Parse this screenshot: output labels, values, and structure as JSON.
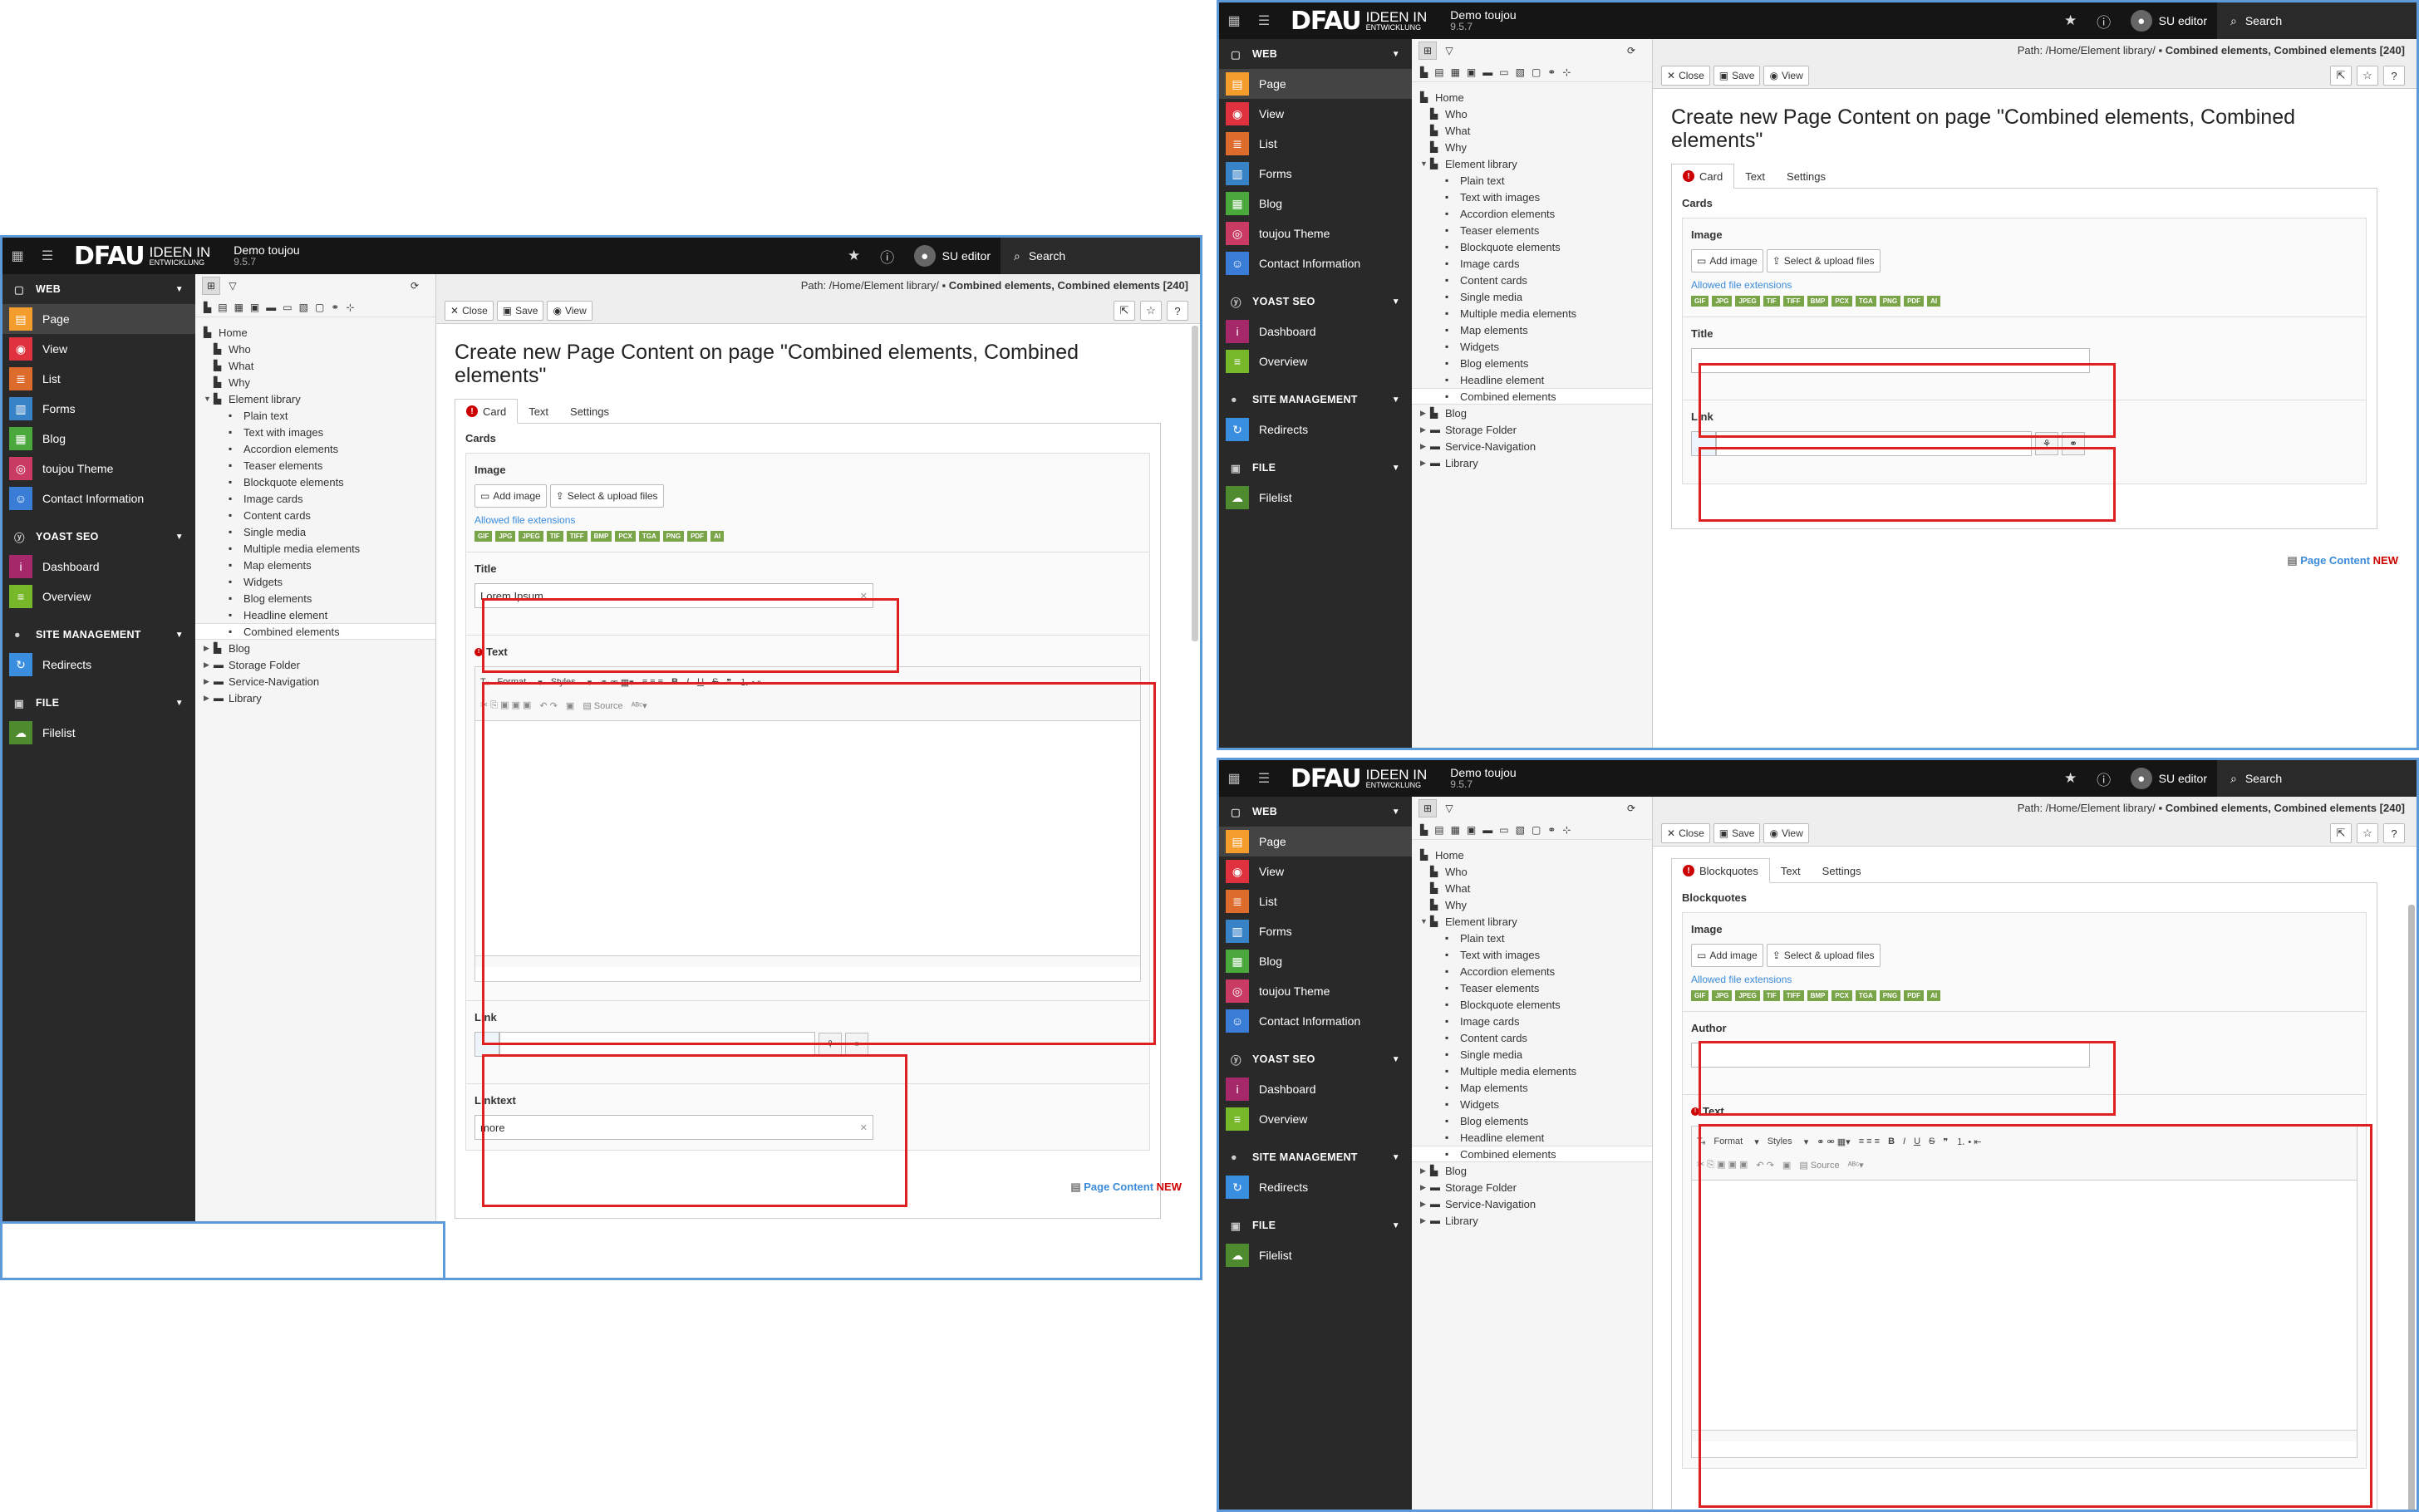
{
  "topbar": {
    "logo_main": "DFAU",
    "logo_sub1": "IDEEN IN",
    "logo_sub2": "ENTWICKLUNG",
    "site_name": "Demo toujou",
    "site_version": "9.5.7",
    "user": "SU editor",
    "search": "Search"
  },
  "modulemenu": {
    "web": "WEB",
    "page": "Page",
    "view": "View",
    "list": "List",
    "forms": "Forms",
    "blog": "Blog",
    "theme": "toujou Theme",
    "contact": "Contact Information",
    "yoast": "YOAST SEO",
    "dashboard": "Dashboard",
    "overview": "Overview",
    "site": "SITE MANAGEMENT",
    "redirects": "Redirects",
    "file": "FILE",
    "filelist": "Filelist"
  },
  "tree": {
    "home": "Home",
    "who": "Who",
    "what": "What",
    "why": "Why",
    "library": "Element library",
    "children": [
      "Plain text",
      "Text with images",
      "Accordion elements",
      "Teaser elements",
      "Blockquote elements",
      "Image cards",
      "Content cards",
      "Single media",
      "Multiple media elements",
      "Map elements",
      "Widgets",
      "Blog elements",
      "Headline element",
      "Combined elements"
    ],
    "blog": "Blog",
    "storage": "Storage Folder",
    "service": "Service-Navigation",
    "lib": "Library"
  },
  "docheader": {
    "path_prefix": "Path: /Home/Element library/",
    "path_page": "Combined elements, Combined elements [240]",
    "close": "Close",
    "save": "Save",
    "view": "View"
  },
  "form": {
    "heading": "Create new Page Content on page \"Combined elements, Combined elements\"",
    "tab_card": "Card",
    "tab_blockquotes": "Blockquotes",
    "tab_text": "Text",
    "tab_settings": "Settings",
    "cards": "Cards",
    "blockquotes": "Blockquotes",
    "image": "Image",
    "add_image": "Add image",
    "upload": "Select & upload files",
    "allowed": "Allowed file extensions",
    "extensions": [
      "GIF",
      "JPG",
      "JPEG",
      "TIF",
      "TIFF",
      "BMP",
      "PCX",
      "TGA",
      "PNG",
      "PDF",
      "AI"
    ],
    "title": "Title",
    "title_value": "Lorem Ipsum",
    "text": "Text",
    "link": "Link",
    "linktext": "Linktext",
    "linktext_value": "more",
    "author": "Author",
    "rte_format": "Format",
    "rte_styles": "Styles",
    "rte_source": "Source",
    "footer_label": "Page Content",
    "footer_new": "NEW"
  },
  "colors": {
    "highlight": "#e02020",
    "frame": "#5e9ad9",
    "accent": "#3b8bd9",
    "extension_badge": "#79a548"
  }
}
